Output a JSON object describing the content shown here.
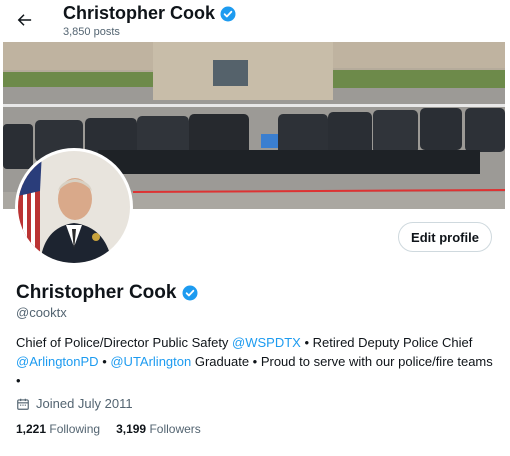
{
  "header": {
    "name": "Christopher Cook",
    "posts_count": "3,850 posts"
  },
  "profile": {
    "name": "Christopher Cook",
    "handle": "@cooktx",
    "edit_label": "Edit profile",
    "bio": {
      "part1": "Chief of Police/Director Public Safety ",
      "mention1": "@WSPDTX",
      "part2": " • Retired Deputy Police Chief ",
      "mention2": "@ArlingtonPD",
      "part3": " • ",
      "mention3": "@UTArlington",
      "part4": " Graduate • Proud to serve with our police/fire teams",
      "part5": "•"
    },
    "joined": "Joined July 2011",
    "following_count": "1,221",
    "following_label": "Following",
    "followers_count": "3,199",
    "followers_label": "Followers"
  },
  "colors": {
    "accent": "#1d9bf0",
    "verified": "#1d9bf0",
    "muted_text": "#536471"
  },
  "icons": [
    "back-arrow-icon",
    "verified-badge-icon",
    "calendar-icon"
  ]
}
